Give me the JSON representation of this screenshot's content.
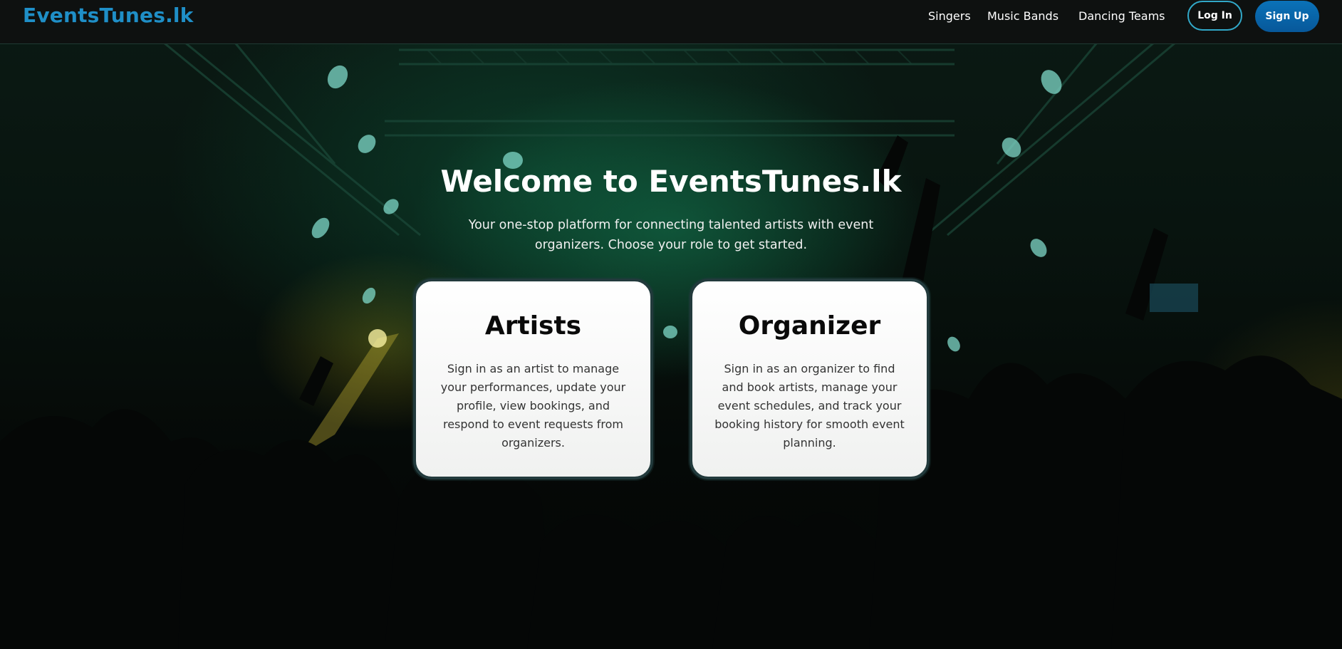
{
  "header": {
    "logo_text": "EventsTunes.lk",
    "nav": [
      "Singers",
      "Music Bands",
      "Dancing Teams"
    ],
    "login_label": "Log In",
    "signup_label": "Sign Up"
  },
  "hero": {
    "title": "Welcome to EventsTunes.lk",
    "subtitle": "Your one-stop platform for connecting talented artists with event organizers. Choose your role to get started."
  },
  "cards": [
    {
      "title": "Artists",
      "description": "Sign in as an artist to manage your performances, update your profile, view bookings, and respond to event requests from organizers."
    },
    {
      "title": "Organizer",
      "description": "Sign in as an organizer to find and book artists, manage your event schedules, and track your booking history for smooth event planning."
    }
  ],
  "colors": {
    "logo": "#1f8fc7",
    "signup_button": "#0a72b8",
    "login_border": "#31a8c8",
    "card_border": "#223a3c"
  }
}
